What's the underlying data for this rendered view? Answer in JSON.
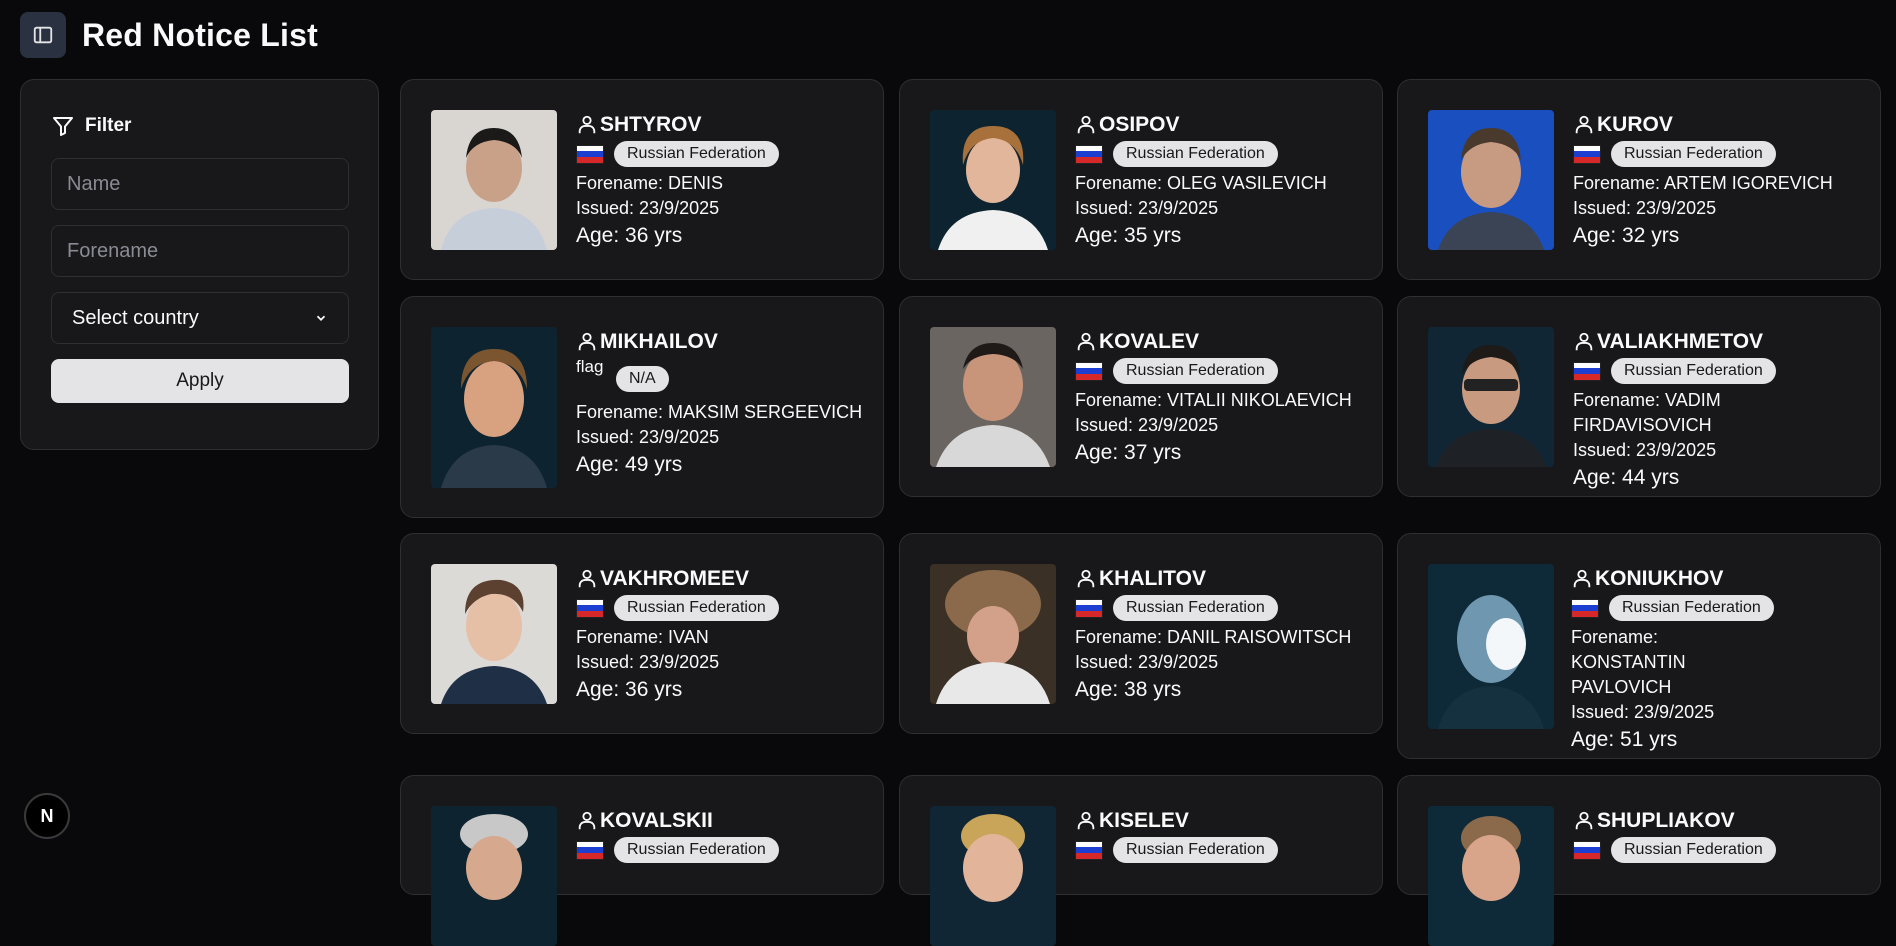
{
  "page": {
    "title": "Red Notice List"
  },
  "filter": {
    "title": "Filter",
    "name_placeholder": "Name",
    "forename_placeholder": "Forename",
    "country_select": "Select country",
    "apply_label": "Apply"
  },
  "notices": [
    {
      "surname": "SHTYROV",
      "nationality": "Russian Federation",
      "forename": "Forename: DENIS",
      "issued": "Issued: 23/9/2025",
      "age": "Age: 36 yrs"
    },
    {
      "surname": "OSIPOV",
      "nationality": "Russian Federation",
      "forename": "Forename: OLEG VASILEVICH",
      "issued": "Issued: 23/9/2025",
      "age": "Age: 35 yrs"
    },
    {
      "surname": "KUROV",
      "nationality": "Russian Federation",
      "forename": "Forename: ARTEM IGOREVICH",
      "issued": "Issued: 23/9/2025",
      "age": "Age: 32 yrs"
    },
    {
      "surname": "MIKHAILOV",
      "nationality": "N/A",
      "flag_alt": "flag",
      "forename": "Forename: MAKSIM SERGEEVICH",
      "issued": "Issued: 23/9/2025",
      "age": "Age: 49 yrs"
    },
    {
      "surname": "KOVALEV",
      "nationality": "Russian Federation",
      "forename": "Forename: VITALII NIKOLAEVICH",
      "issued": "Issued: 23/9/2025",
      "age": "Age: 37 yrs"
    },
    {
      "surname": "VALIAKHMETOV",
      "nationality": "Russian Federation",
      "forename": "Forename: VADIM FIRDAVISOVICH",
      "issued": "Issued: 23/9/2025",
      "age": "Age: 44 yrs"
    },
    {
      "surname": "VAKHROMEEV",
      "nationality": "Russian Federation",
      "forename": "Forename: IVAN",
      "issued": "Issued: 23/9/2025",
      "age": "Age: 36 yrs"
    },
    {
      "surname": "KHALITOV",
      "nationality": "Russian Federation",
      "forename": "Forename: DANIL RAISOWITSCH",
      "issued": "Issued: 23/9/2025",
      "age": "Age: 38 yrs"
    },
    {
      "surname": "KONIUKHOV",
      "nationality": "Russian Federation",
      "forename": "Forename: KONSTANTIN PAVLOVICH",
      "issued": "Issued: 23/9/2025",
      "age": "Age: 51 yrs"
    },
    {
      "surname": "KOVALSKII",
      "nationality": "Russian Federation"
    },
    {
      "surname": "KISELEV",
      "nationality": "Russian Federation"
    },
    {
      "surname": "SHUPLIAKOV",
      "nationality": "Russian Federation"
    }
  ],
  "fab": {
    "label": "N"
  },
  "colors": {
    "background": "#09090b",
    "card": "#18181b",
    "badge": "#e4e4e7",
    "toggle": "#2a3140"
  }
}
